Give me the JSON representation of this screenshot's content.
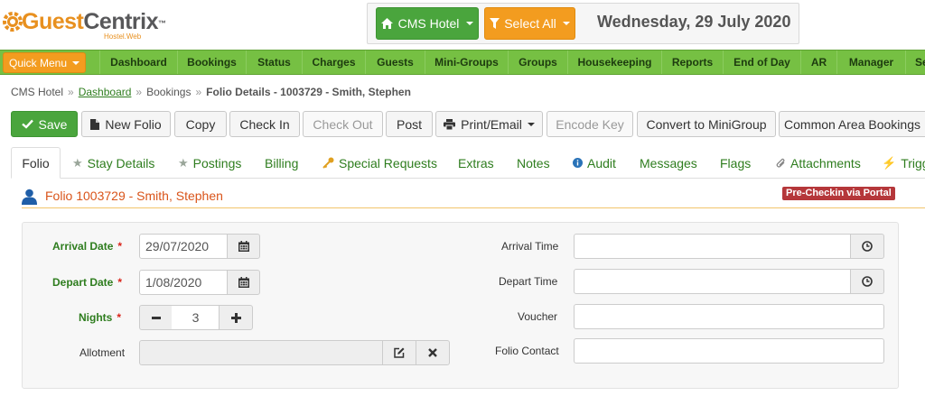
{
  "brand": {
    "logo_part1": "Guest",
    "logo_part2": "Centrix",
    "trademark": "™",
    "sub": "Hostel.Web",
    "orange": "#e8901f",
    "green": "#76c043"
  },
  "header": {
    "hotel_button": "CMS Hotel",
    "select_button": "Select All",
    "date": "Wednesday, 29 July 2020"
  },
  "nav": {
    "quick_menu": "Quick Menu",
    "items": [
      "Dashboard",
      "Bookings",
      "Status",
      "Charges",
      "Guests",
      "Mini-Groups",
      "Groups",
      "Housekeeping",
      "Reports",
      "End of Day",
      "AR",
      "Manager",
      "Se"
    ]
  },
  "breadcrumb": {
    "root": "CMS Hotel",
    "sep": "»",
    "link": "Dashboard",
    "section": "Bookings",
    "current": "Folio Details - 1003729 - Smith, Stephen"
  },
  "toolbar": {
    "save": "Save",
    "new_folio": "New Folio",
    "copy": "Copy",
    "check_in": "Check In",
    "check_out": "Check Out",
    "post": "Post",
    "print_email": "Print/Email",
    "encode_key": "Encode Key",
    "convert": "Convert to MiniGroup",
    "common_area": "Common Area Bookings"
  },
  "tabs": {
    "folio": "Folio",
    "stay_details": "Stay Details",
    "postings": "Postings",
    "billing": "Billing",
    "special_requests": "Special Requests",
    "extras": "Extras",
    "notes": "Notes",
    "audit": "Audit",
    "messages": "Messages",
    "flags": "Flags",
    "attachments": "Attachments",
    "triggers": "Trigg"
  },
  "folio": {
    "title": "Folio 1003729 - Smith, Stephen",
    "badge": "Pre-Checkin via Portal"
  },
  "form": {
    "arrival_date_label": "Arrival Date",
    "arrival_date_value": "29/07/2020",
    "depart_date_label": "Depart Date",
    "depart_date_value": "1/08/2020",
    "nights_label": "Nights",
    "nights_value": "3",
    "required_mark": "*",
    "allotment_label": "Allotment",
    "allotment_value": "",
    "arrival_time_label": "Arrival Time",
    "arrival_time_value": "",
    "depart_time_label": "Depart Time",
    "depart_time_value": "",
    "voucher_label": "Voucher",
    "voucher_value": "",
    "folio_contact_label": "Folio Contact",
    "folio_contact_value": ""
  }
}
